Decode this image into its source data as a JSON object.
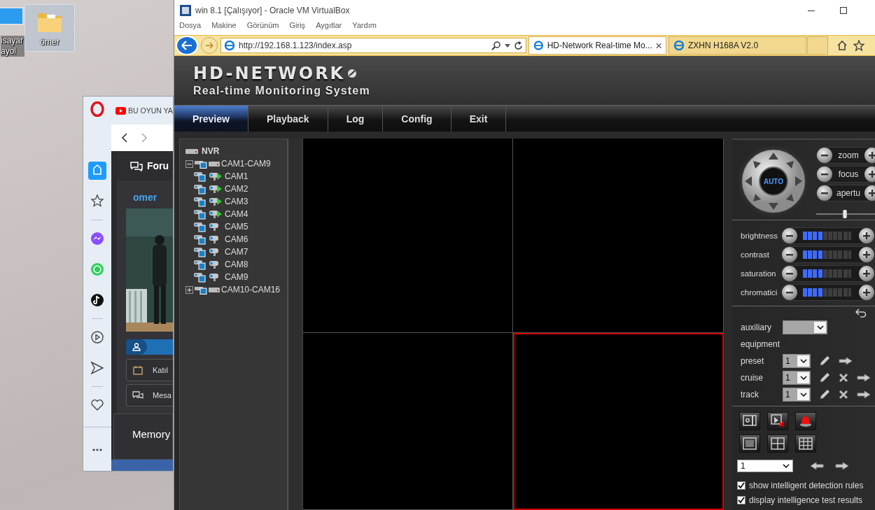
{
  "desktop": {
    "icons": [
      {
        "label": "isayar ayol",
        "selected": false
      },
      {
        "label": "ömer",
        "selected": true
      }
    ]
  },
  "opera": {
    "sidebar": [
      {
        "selected": true
      },
      {
        "selected": false
      },
      {
        "selected": false
      },
      {
        "selected": false
      },
      {
        "selected": false
      },
      {
        "selected": false
      },
      {
        "selected": false
      },
      {
        "selected": false
      },
      {
        "selected": false
      }
    ],
    "tab_title": "BU OYUN YA",
    "page": {
      "heading": "Foru",
      "username": "omer",
      "rows": [
        {
          "label": "Katıl"
        },
        {
          "label": "Mesa"
        }
      ],
      "panel_title": "Memory"
    }
  },
  "window": {
    "title": "win 8.1 [Çalışıyor] - Oracle VM VirtualBox",
    "menu": [
      "Dosya",
      "Makine",
      "Görünüm",
      "Giriş",
      "Aygıtlar",
      "Yardım"
    ]
  },
  "browser": {
    "address": "http://192.168.1.123/index.asp",
    "tabs": [
      {
        "title": "HD-Network Real-time Mo...",
        "selected": true
      },
      {
        "title": "ZXHN H168A V2.0",
        "selected": false
      }
    ]
  },
  "nvr": {
    "logo": "HD-NETWORK",
    "subtitle": "Real-time Monitoring System",
    "tabs": [
      {
        "label": "Preview",
        "selected": true
      },
      {
        "label": "Playback",
        "selected": false
      },
      {
        "label": "Log",
        "selected": false
      },
      {
        "label": "Config",
        "selected": false
      },
      {
        "label": "Exit",
        "selected": false
      }
    ],
    "tree": [
      {
        "kind": "nvr",
        "label": "NVR",
        "children": [
          {
            "kind": "group",
            "label": "CAM1-CAM9",
            "expanded": true,
            "children": [
              {
                "kind": "camera",
                "label": "CAM1",
                "live": true
              },
              {
                "kind": "camera",
                "label": "CAM2",
                "live": true
              },
              {
                "kind": "camera",
                "label": "CAM3",
                "live": true
              },
              {
                "kind": "camera",
                "label": "CAM4",
                "live": true
              },
              {
                "kind": "camera",
                "label": "CAM5",
                "live": false
              },
              {
                "kind": "camera",
                "label": "CAM6",
                "live": false
              },
              {
                "kind": "camera",
                "label": "CAM7",
                "live": false
              },
              {
                "kind": "camera",
                "label": "CAM8",
                "live": false
              },
              {
                "kind": "camera",
                "label": "CAM9",
                "live": false
              }
            ]
          },
          {
            "kind": "group",
            "label": "CAM10-CAM16",
            "expanded": false
          }
        ]
      }
    ],
    "video_cells": [
      {
        "selected": false
      },
      {
        "selected": false
      },
      {
        "selected": false
      },
      {
        "selected": true
      }
    ],
    "ptz": {
      "center": "AUTO",
      "lens": [
        {
          "label": "zoom"
        },
        {
          "label": "focus"
        },
        {
          "label": "apertu"
        }
      ],
      "speed": {
        "level": 0.45
      }
    },
    "image": [
      {
        "label": "brightness",
        "level": 0.4
      },
      {
        "label": "contrast",
        "level": 0.4
      },
      {
        "label": "saturation",
        "level": 0.4
      },
      {
        "label": "chromatici",
        "level": 0.4
      }
    ],
    "auxiliary": {
      "label": "auxiliary"
    },
    "equipment": "equipment",
    "positions": [
      {
        "label": "preset",
        "value": "1",
        "deletable": false
      },
      {
        "label": "cruise",
        "value": "1",
        "deletable": true
      },
      {
        "label": "track",
        "value": "1",
        "deletable": true
      }
    ],
    "window_select": "1",
    "options": [
      {
        "label": "show intelligent detection rules",
        "checked": true
      },
      {
        "label": "display intelligence test results",
        "checked": true
      }
    ]
  }
}
